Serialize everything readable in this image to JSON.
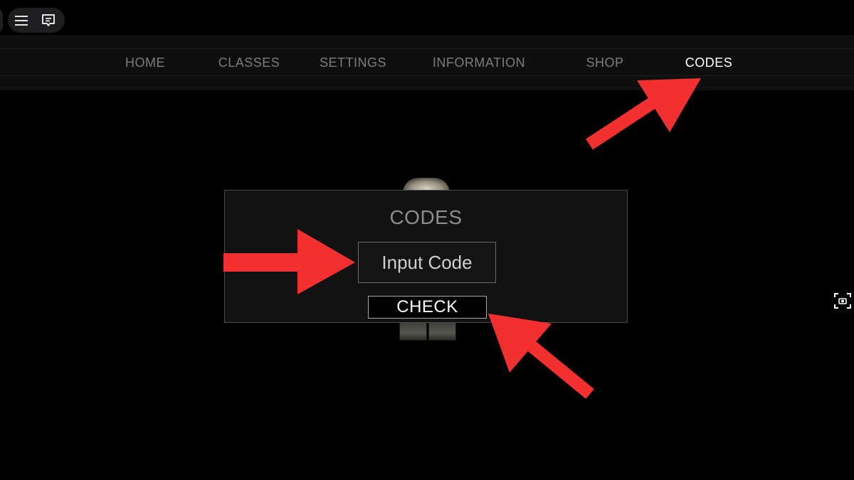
{
  "colors": {
    "background": "#000000",
    "navbar": "#0f0f0f",
    "nav_inactive": "#7c7c7c",
    "nav_active": "#ffffff",
    "panel": "#121212",
    "annotation_arrow": "#f23030"
  },
  "top_controls": {
    "menu_icon": "hamburger-menu-icon",
    "chat_icon": "chat-icon"
  },
  "nav": {
    "items": [
      {
        "label": "HOME"
      },
      {
        "label": "CLASSES"
      },
      {
        "label": "SETTINGS"
      },
      {
        "label": "INFORMATION"
      },
      {
        "label": "SHOP"
      },
      {
        "label": "CODES",
        "active": true
      }
    ]
  },
  "codes_panel": {
    "title": "CODES",
    "input_placeholder": "Input Code",
    "input_value": "",
    "check_label": "CHECK"
  },
  "side_controls": {
    "screenshot_icon": "screenshot-camera-icon"
  },
  "annotations": {
    "arrow_icon": "red-arrow-icon",
    "count": 3
  }
}
